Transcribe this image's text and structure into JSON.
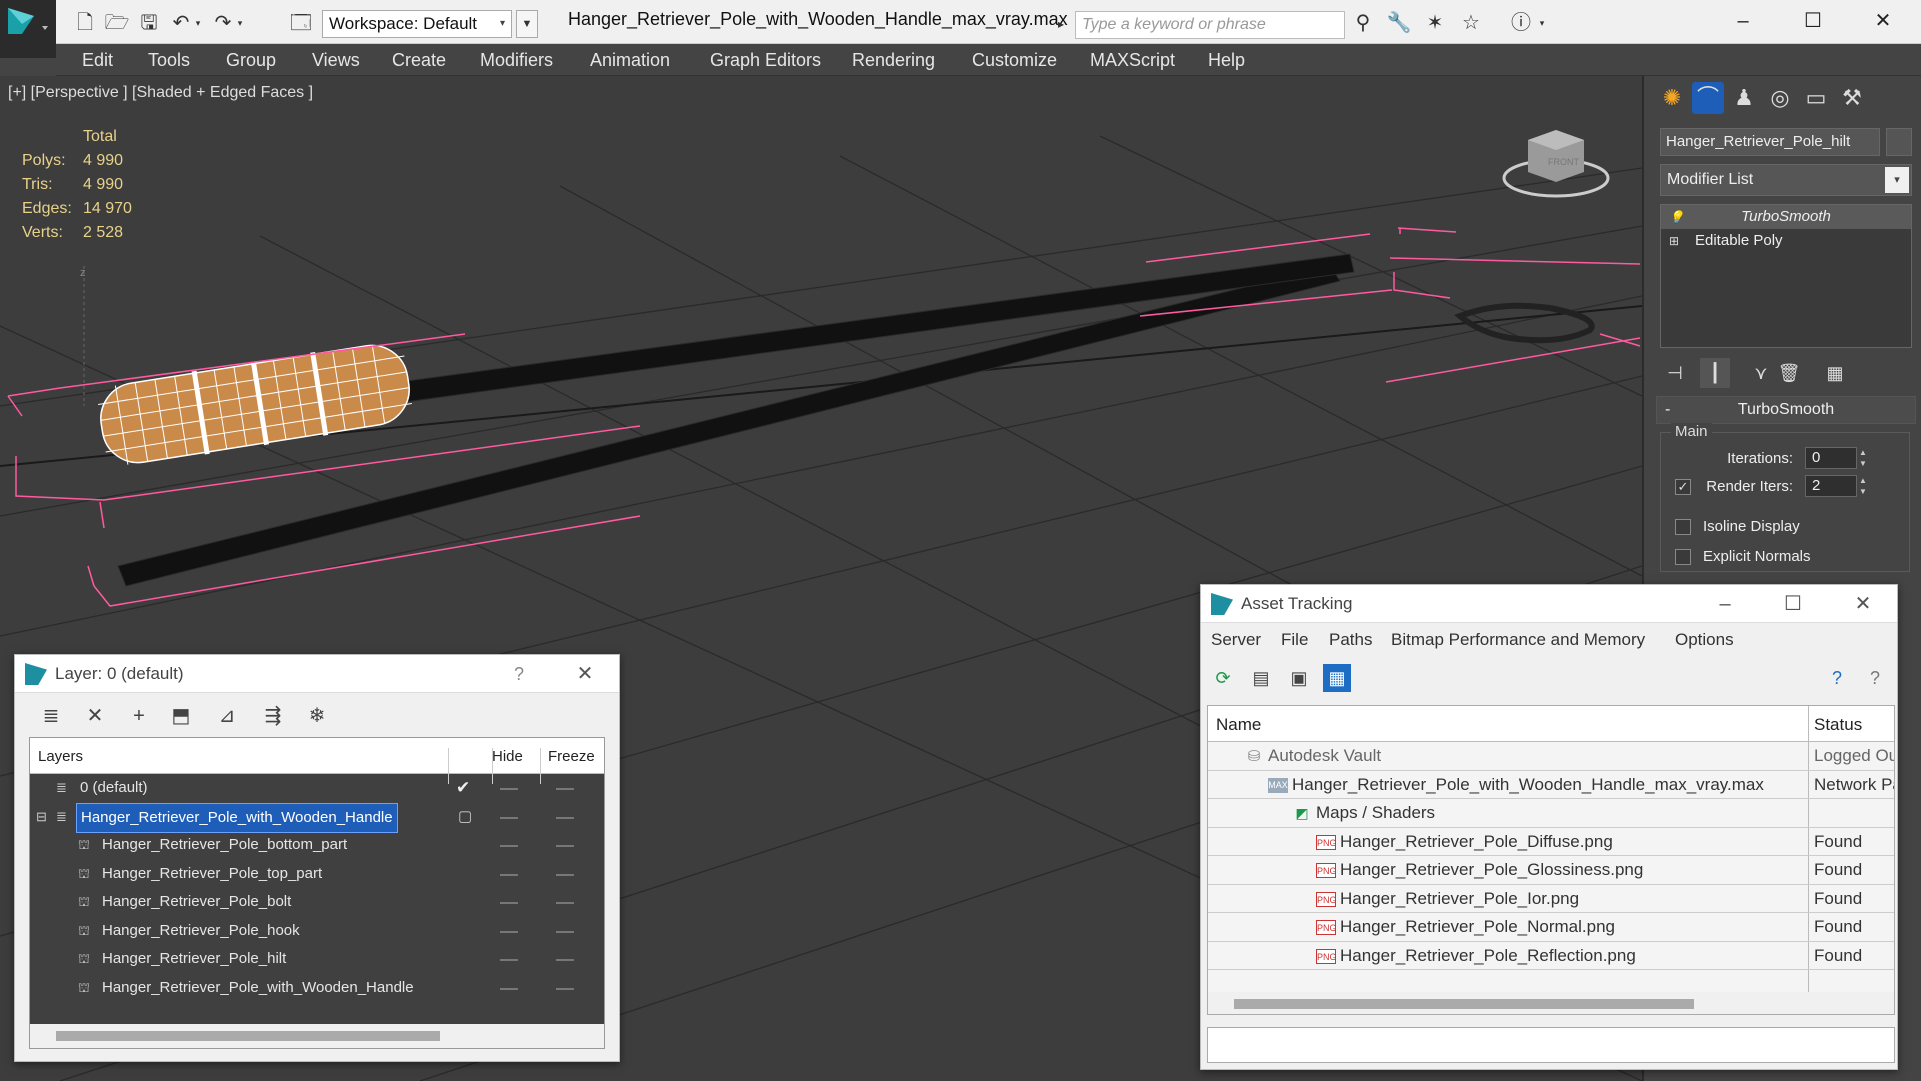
{
  "window": {
    "title": "Hanger_Retriever_Pole_with_Wooden_Handle_max_vray.max",
    "workspace_label": "Workspace: Default",
    "search_placeholder": "Type a keyword or phrase"
  },
  "menu": [
    "Edit",
    "Tools",
    "Group",
    "Views",
    "Create",
    "Modifiers",
    "Animation",
    "Graph Editors",
    "Rendering",
    "Customize",
    "MAXScript",
    "Help"
  ],
  "viewport": {
    "label": "[+] [Perspective ] [Shaded + Edged Faces ]",
    "stats": {
      "header": "Total",
      "rows": [
        {
          "key": "Polys:",
          "value": "4 990"
        },
        {
          "key": "Tris:",
          "value": "4 990"
        },
        {
          "key": "Edges:",
          "value": "14 970"
        },
        {
          "key": "Verts:",
          "value": "2 528"
        }
      ]
    },
    "viewcube_label": "FRONT"
  },
  "command_panel": {
    "object_name": "Hanger_Retriever_Pole_hilt",
    "modifier_list_label": "Modifier List",
    "stack": [
      "TurboSmooth",
      "Editable Poly"
    ],
    "rollout_title": "TurboSmooth",
    "group_label": "Main",
    "iterations_label": "Iterations:",
    "iterations_value": "0",
    "render_iters_label": "Render Iters:",
    "render_iters_value": "2",
    "render_iters_checked": true,
    "isoline_label": "Isoline Display",
    "explicit_normals_label": "Explicit Normals"
  },
  "layer_window": {
    "title": "Layer: 0 (default)",
    "help": "?",
    "columns": {
      "layers": "Layers",
      "hide": "Hide",
      "freeze": "Freeze"
    },
    "rows": [
      {
        "name": "0 (default)",
        "level": 0,
        "type": "layer",
        "selected": false,
        "current": true
      },
      {
        "name": "Hanger_Retriever_Pole_with_Wooden_Handle",
        "level": 0,
        "type": "layer",
        "selected": true,
        "current": false
      },
      {
        "name": "Hanger_Retriever_Pole_bottom_part",
        "level": 1,
        "type": "object",
        "selected": false,
        "current": false
      },
      {
        "name": "Hanger_Retriever_Pole_top_part",
        "level": 1,
        "type": "object",
        "selected": false,
        "current": false
      },
      {
        "name": "Hanger_Retriever_Pole_bolt",
        "level": 1,
        "type": "object",
        "selected": false,
        "current": false
      },
      {
        "name": "Hanger_Retriever_Pole_hook",
        "level": 1,
        "type": "object",
        "selected": false,
        "current": false
      },
      {
        "name": "Hanger_Retriever_Pole_hilt",
        "level": 1,
        "type": "object",
        "selected": false,
        "current": false
      },
      {
        "name": "Hanger_Retriever_Pole_with_Wooden_Handle",
        "level": 1,
        "type": "object",
        "selected": false,
        "current": false
      }
    ]
  },
  "asset_window": {
    "title": "Asset Tracking",
    "menu": [
      "Server",
      "File",
      "Paths",
      "Bitmap Performance and Memory",
      "Options"
    ],
    "columns": {
      "name": "Name",
      "status": "Status"
    },
    "rows": [
      {
        "name": "Autodesk Vault",
        "level": 1,
        "icon": "vault",
        "status": "Logged Out"
      },
      {
        "name": "Hanger_Retriever_Pole_with_Wooden_Handle_max_vray.max",
        "level": 2,
        "icon": "max",
        "status": "Network Path"
      },
      {
        "name": "Maps / Shaders",
        "level": 3,
        "icon": "maps",
        "status": ""
      },
      {
        "name": "Hanger_Retriever_Pole_Diffuse.png",
        "level": 4,
        "icon": "png",
        "status": "Found"
      },
      {
        "name": "Hanger_Retriever_Pole_Glossiness.png",
        "level": 4,
        "icon": "png",
        "status": "Found"
      },
      {
        "name": "Hanger_Retriever_Pole_Ior.png",
        "level": 4,
        "icon": "png",
        "status": "Found"
      },
      {
        "name": "Hanger_Retriever_Pole_Normal.png",
        "level": 4,
        "icon": "png",
        "status": "Found"
      },
      {
        "name": "Hanger_Retriever_Pole_Reflection.png",
        "level": 4,
        "icon": "png",
        "status": "Found"
      }
    ]
  },
  "colors": {
    "accent": "#1e5eb8",
    "selection_bracket": "#ff5aa0",
    "stats_text": "#e8d28a",
    "viewport_bg": "#3d3d3d"
  }
}
